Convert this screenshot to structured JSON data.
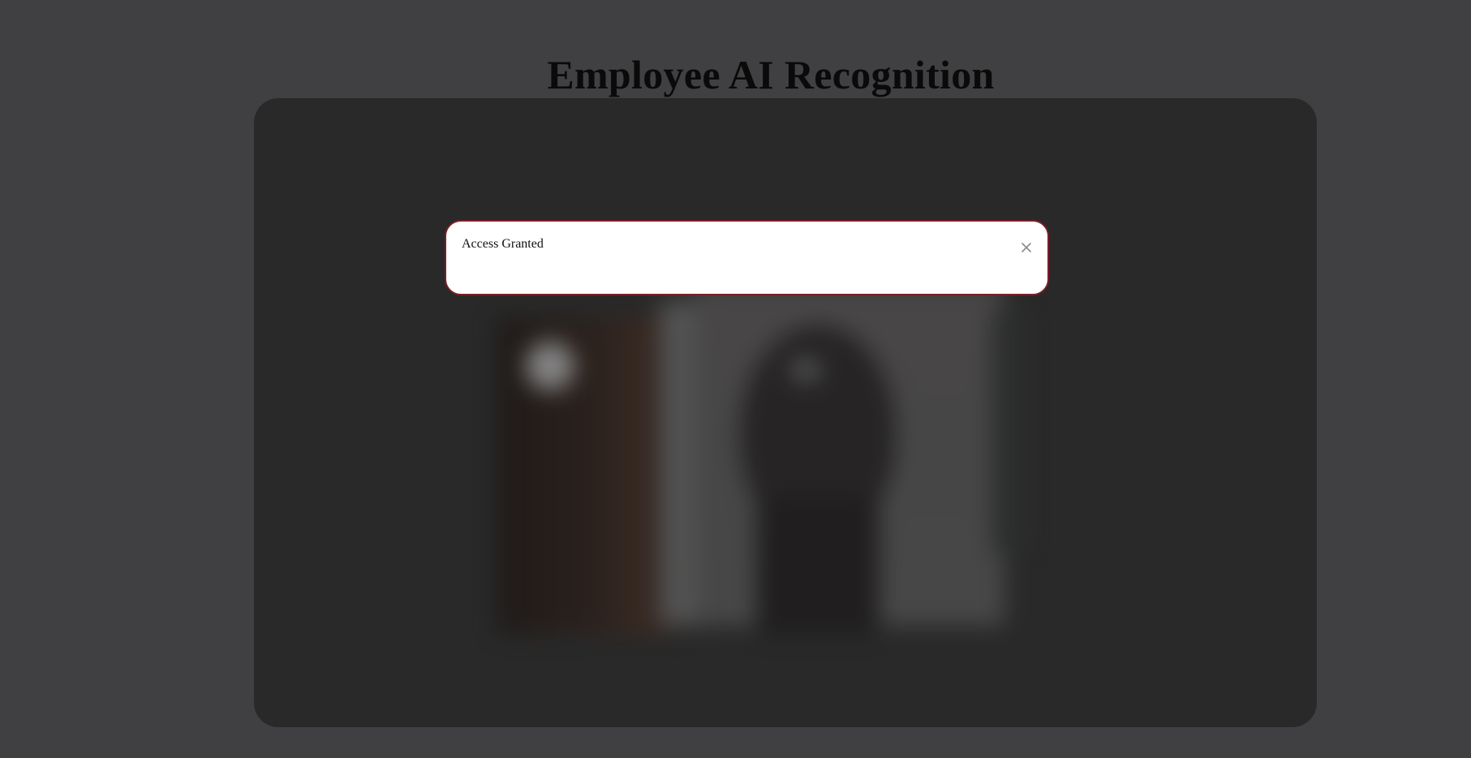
{
  "page": {
    "title": "Employee AI Recognition"
  },
  "alert": {
    "message": "Access Granted",
    "close_icon": "close-icon",
    "border_color": "#7a1f28"
  },
  "camera": {
    "panel_color": "#292929",
    "background_color": "#404042"
  }
}
